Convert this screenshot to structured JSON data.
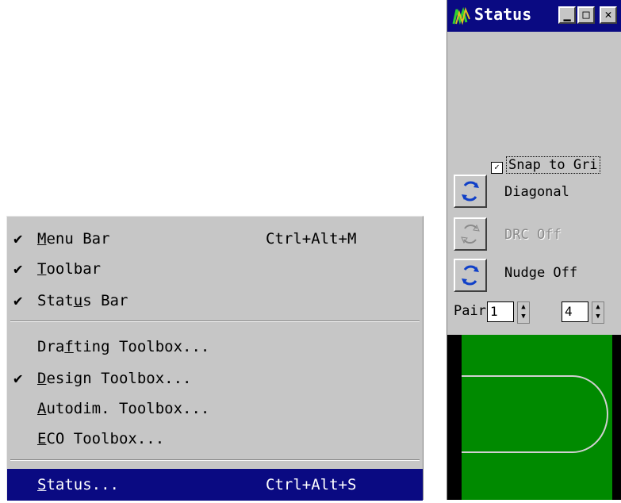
{
  "menu": {
    "items": [
      {
        "checked": true,
        "before": "",
        "accel": "M",
        "after": "enu Bar",
        "shortcut": "Ctrl+Alt+M"
      },
      {
        "checked": true,
        "before": "",
        "accel": "T",
        "after": "oolbar",
        "shortcut": ""
      },
      {
        "checked": true,
        "before": "Stat",
        "accel": "u",
        "after": "s Bar",
        "shortcut": ""
      },
      {
        "checked": false,
        "before": "Dra",
        "accel": "f",
        "after": "ting Toolbox...",
        "shortcut": ""
      },
      {
        "checked": true,
        "before": "",
        "accel": "D",
        "after": "esign Toolbox...",
        "shortcut": ""
      },
      {
        "checked": false,
        "before": "",
        "accel": "A",
        "after": "utodim. Toolbox...",
        "shortcut": ""
      },
      {
        "checked": false,
        "before": "",
        "accel": "E",
        "after": "CO Toolbox...",
        "shortcut": ""
      },
      {
        "checked": false,
        "before": "",
        "accel": "S",
        "after": "tatus...",
        "shortcut": "Ctrl+Alt+S",
        "selected": true
      }
    ],
    "check_glyph": "✔",
    "colors": {
      "background": "#c6c6c6",
      "highlight": "#0a0a82"
    }
  },
  "status_window": {
    "title": "Status",
    "title_buttons": {
      "minimize": "▁",
      "maximize": "□",
      "close": "✕"
    },
    "snap_checkbox": {
      "label": "Snap to Gri",
      "checked": true,
      "mark": "✓"
    },
    "mode_buttons": [
      {
        "label": "Diagonal",
        "enabled": true,
        "icon": "rotate-arrows-icon"
      },
      {
        "label": "DRC Off",
        "enabled": false,
        "icon": "rotate-arrows-icon"
      },
      {
        "label": "Nudge Off",
        "enabled": true,
        "icon": "rotate-arrows-icon"
      }
    ],
    "pair": {
      "label": "Pair",
      "first": "1",
      "second": "4",
      "spin_up": "▲",
      "spin_down": "▼"
    },
    "preview": {
      "background": "#008a00",
      "frame": "#000000",
      "outline": "#d0d0d0"
    },
    "colors": {
      "titlebar": "#0a0a82",
      "face": "#c6c6c6",
      "icon_blue": "#1040c8"
    }
  }
}
